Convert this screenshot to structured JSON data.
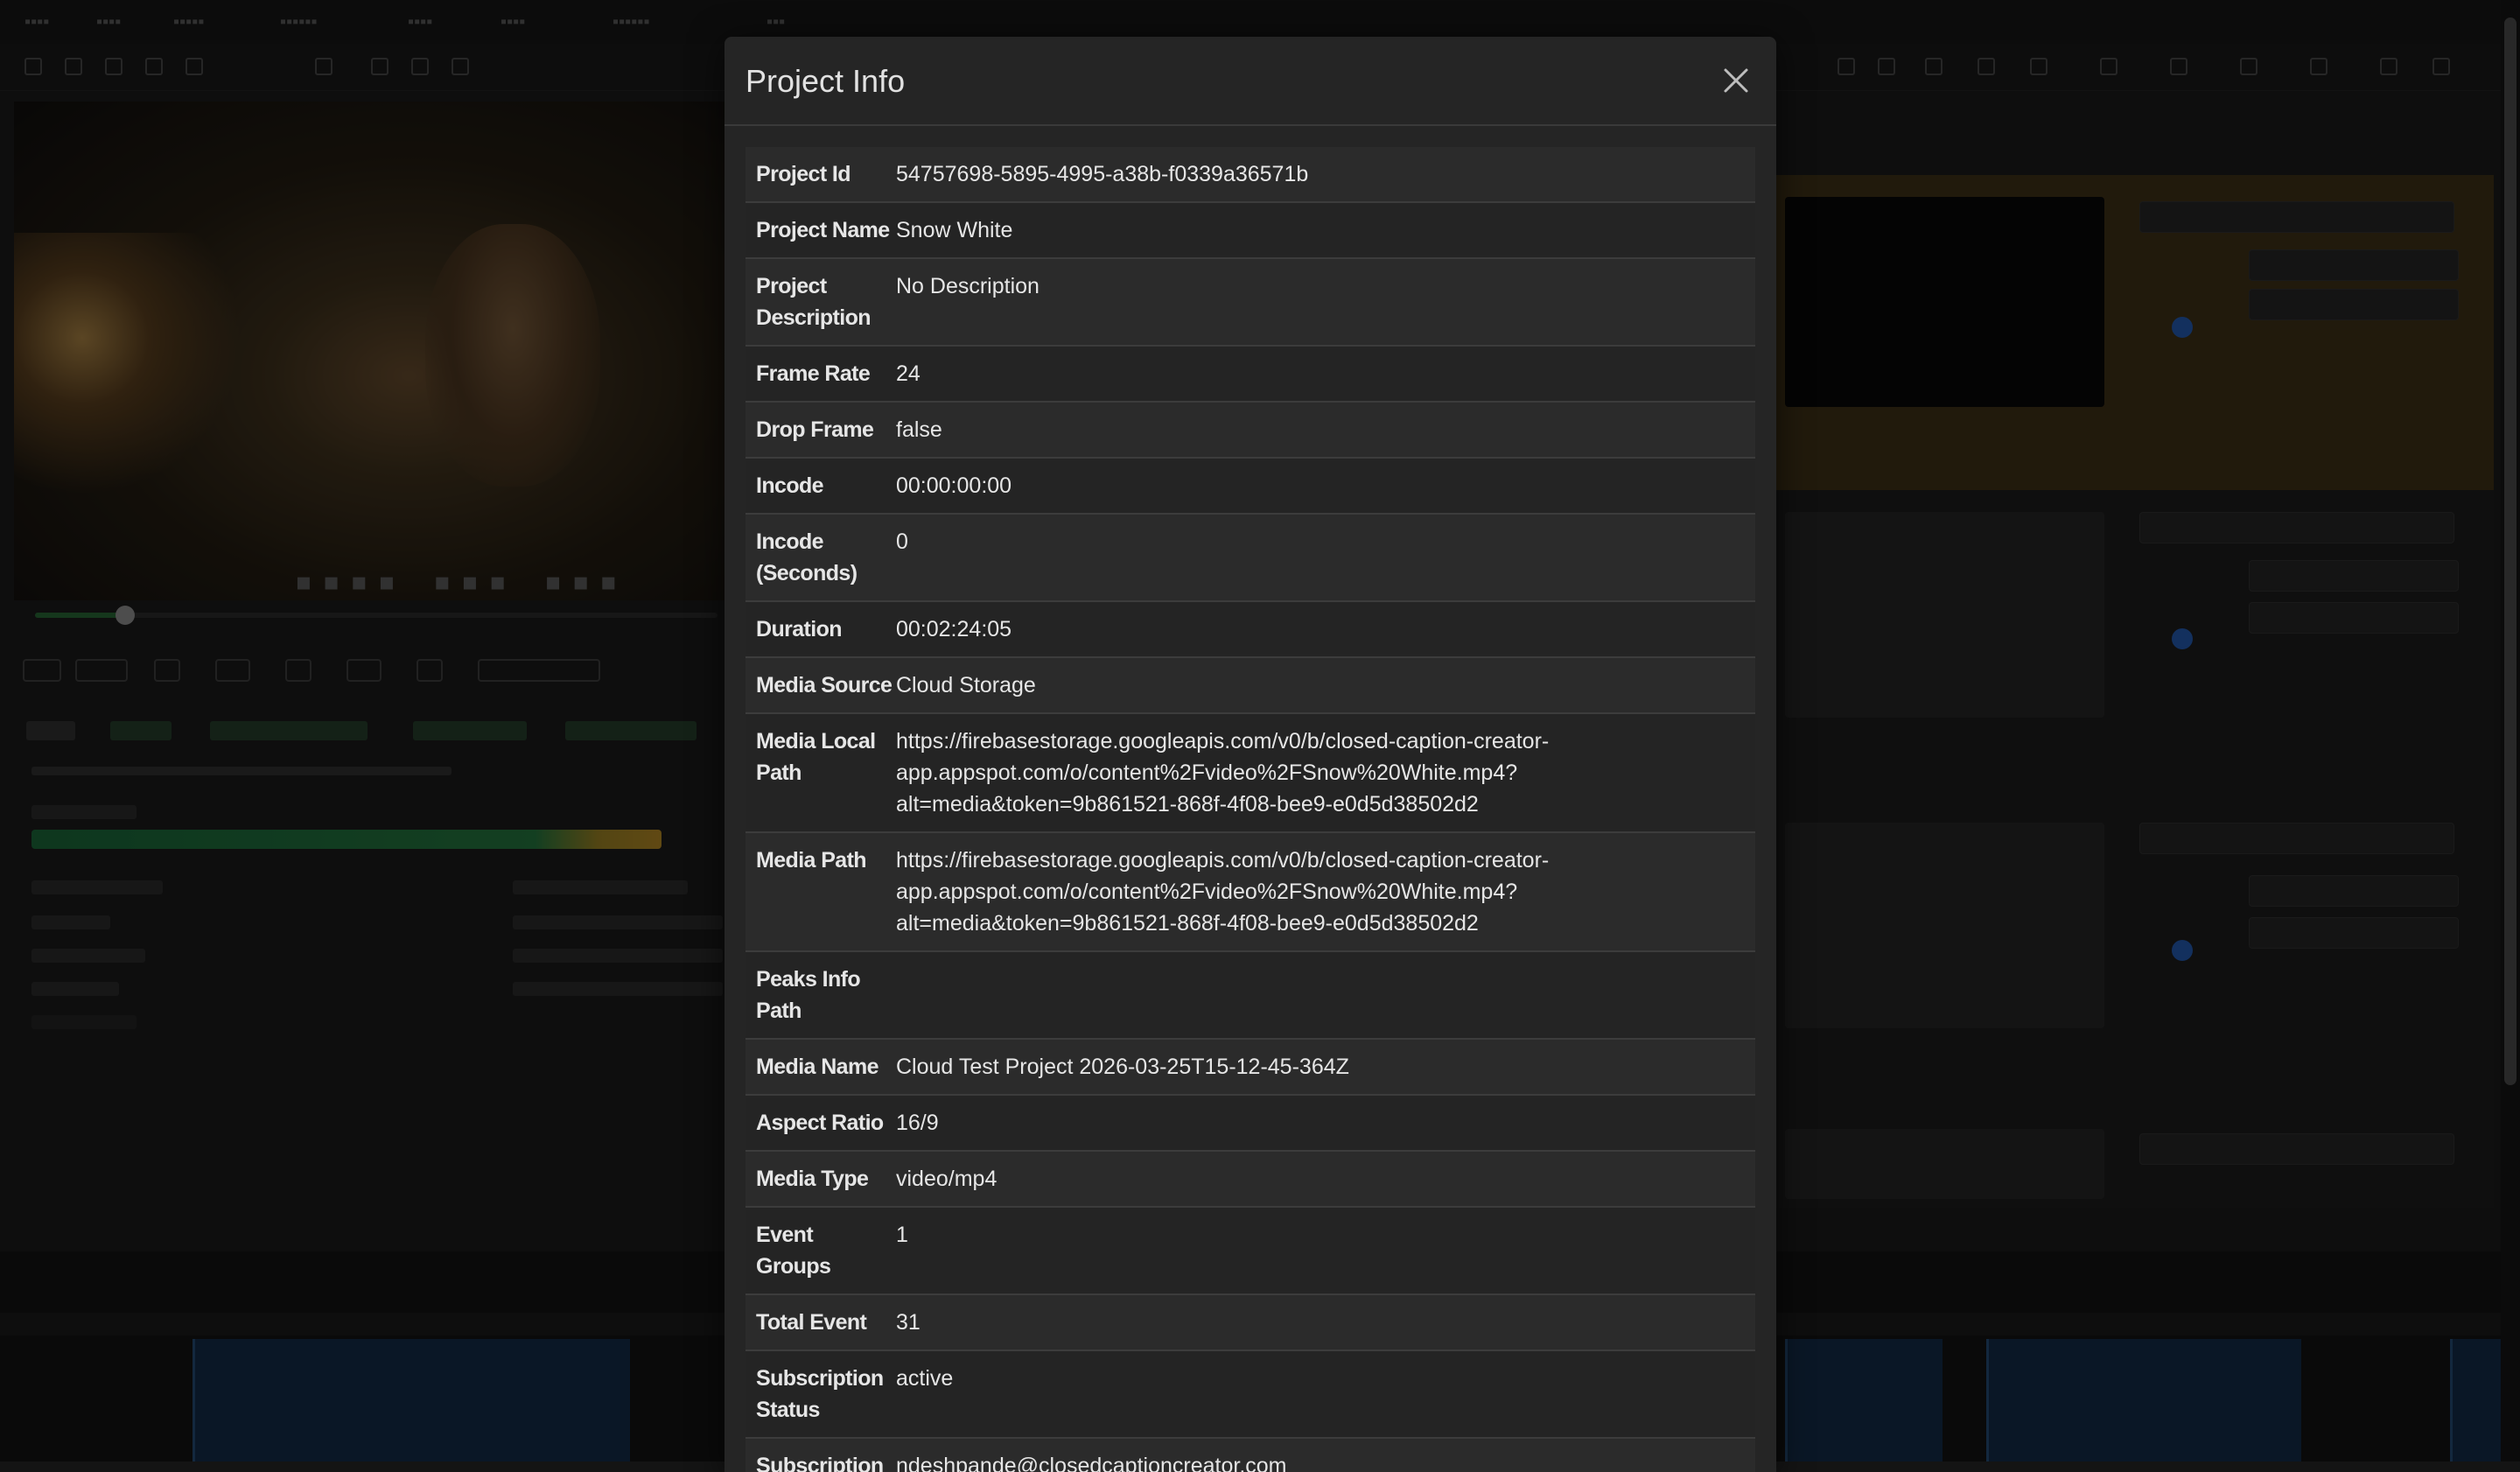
{
  "modal": {
    "title": "Project Info",
    "close_label": "close"
  },
  "project_info": [
    {
      "label": "Project Id",
      "value": "54757698-5895-4995-a38b-f0339a36571b"
    },
    {
      "label": "Project Name",
      "value": "Snow White"
    },
    {
      "label": "Project Description",
      "value": "No Description"
    },
    {
      "label": "Frame Rate",
      "value": "24"
    },
    {
      "label": "Drop Frame",
      "value": "false"
    },
    {
      "label": "Incode",
      "value": "00:00:00:00"
    },
    {
      "label": "Incode (Seconds)",
      "value": "0"
    },
    {
      "label": "Duration",
      "value": "00:02:24:05"
    },
    {
      "label": "Media Source",
      "value": "Cloud Storage"
    },
    {
      "label": "Media Local Path",
      "value": "https://firebasestorage.googleapis.com/v0/b/closed-caption-creator-app.appspot.com/o/content%2Fvideo%2FSnow%20White.mp4?alt=media&token=9b861521-868f-4f08-bee9-e0d5d38502d2"
    },
    {
      "label": "Media Path",
      "value": "https://firebasestorage.googleapis.com/v0/b/closed-caption-creator-app.appspot.com/o/content%2Fvideo%2FSnow%20White.mp4?alt=media&token=9b861521-868f-4f08-bee9-e0d5d38502d2"
    },
    {
      "label": "Peaks Info Path",
      "value": ""
    },
    {
      "label": "Media Name",
      "value": "Cloud Test Project 2026-03-25T15-12-45-364Z"
    },
    {
      "label": "Aspect Ratio",
      "value": "16/9"
    },
    {
      "label": "Media Type",
      "value": "video/mp4"
    },
    {
      "label": "Event Groups",
      "value": "1"
    },
    {
      "label": "Total Event",
      "value": "31"
    },
    {
      "label": "Subscription Status",
      "value": "active"
    },
    {
      "label": "Subscription Owner",
      "value": "ndeshpande@closedcaptioncreator.com"
    }
  ],
  "colors": {
    "modal_bg": "#252525",
    "row_odd": "#2b2b2b",
    "row_even": "#242424",
    "text": "#e6e6e6",
    "progress_green": "#2c8c4a",
    "progress_yellow": "#d6a22a",
    "highlight_panel": "#4a3a1c"
  },
  "icons": {
    "close": "close-icon"
  }
}
